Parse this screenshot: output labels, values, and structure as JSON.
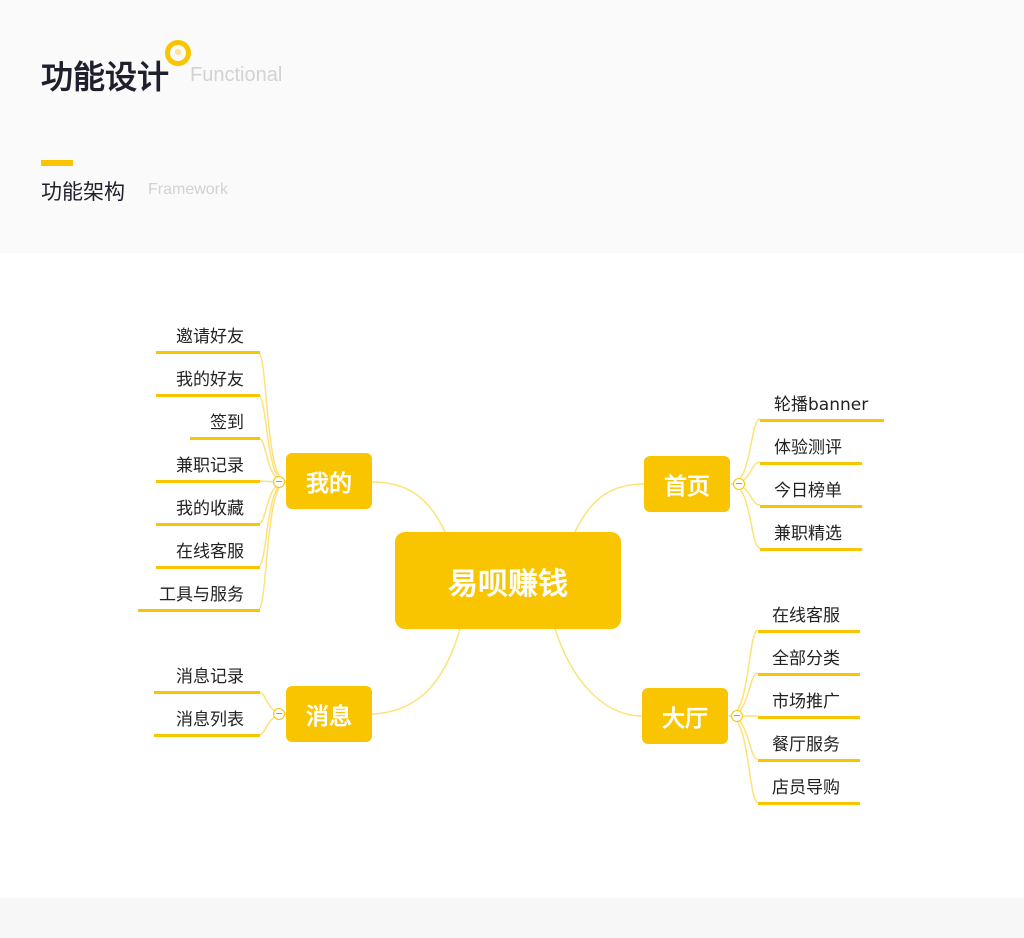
{
  "header": {
    "title": "功能设计",
    "title_en": "Functional",
    "subtitle": "功能架构",
    "subtitle_en": "Framework"
  },
  "mindmap": {
    "center": "易呗赚钱",
    "branches": {
      "mine": {
        "label": "我的",
        "children": [
          "邀请好友",
          "我的好友",
          "签到",
          "兼职记录",
          "我的收藏",
          "在线客服",
          "工具与服务"
        ]
      },
      "messages": {
        "label": "消息",
        "children": [
          "消息记录",
          "消息列表"
        ]
      },
      "home": {
        "label": "首页",
        "children": [
          "轮播banner",
          "体验测评",
          "今日榜单",
          "兼职精选"
        ]
      },
      "hall": {
        "label": "大厅",
        "children": [
          "在线客服",
          "全部分类",
          "市场推广",
          "餐厅服务",
          "店员导购"
        ]
      }
    }
  },
  "colors": {
    "accent": "#f9c500",
    "line": "#fde27a"
  }
}
